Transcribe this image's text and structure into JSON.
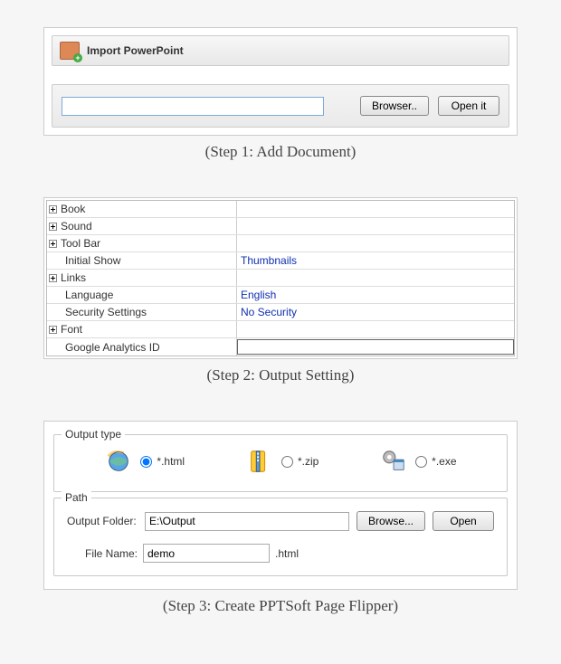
{
  "step1": {
    "import_label": "Import PowerPoint",
    "source_value": "",
    "browse_label": "Browser..",
    "open_label": "Open it",
    "caption": "(Step 1: Add Document)"
  },
  "step2": {
    "rows": [
      {
        "key": "Book",
        "value": "",
        "expandable": true,
        "indent": false
      },
      {
        "key": "Sound",
        "value": "",
        "expandable": true,
        "indent": false
      },
      {
        "key": "Tool Bar",
        "value": "",
        "expandable": true,
        "indent": false
      },
      {
        "key": "Initial Show",
        "value": "Thumbnails",
        "expandable": false,
        "indent": true
      },
      {
        "key": "Links",
        "value": "",
        "expandable": true,
        "indent": false
      },
      {
        "key": "Language",
        "value": "English",
        "expandable": false,
        "indent": true
      },
      {
        "key": "Security Settings",
        "value": "No Security",
        "expandable": false,
        "indent": true
      },
      {
        "key": "Font",
        "value": "",
        "expandable": true,
        "indent": false
      },
      {
        "key": "Google Analytics ID",
        "value": "",
        "expandable": false,
        "indent": true,
        "editable": true
      }
    ],
    "caption": "(Step 2: Output Setting)"
  },
  "step3": {
    "output_type_legend": "Output type",
    "types": {
      "html": "*.html",
      "zip": "*.zip",
      "exe": "*.exe",
      "selected": "html"
    },
    "path_legend": "Path",
    "output_folder_label": "Output Folder:",
    "output_folder_value": "E:\\Output",
    "browse_label": "Browse...",
    "open_label": "Open",
    "file_name_label": "File Name:",
    "file_name_value": "demo",
    "file_ext": ".html",
    "caption": "(Step 3: Create PPTSoft Page Flipper)"
  }
}
